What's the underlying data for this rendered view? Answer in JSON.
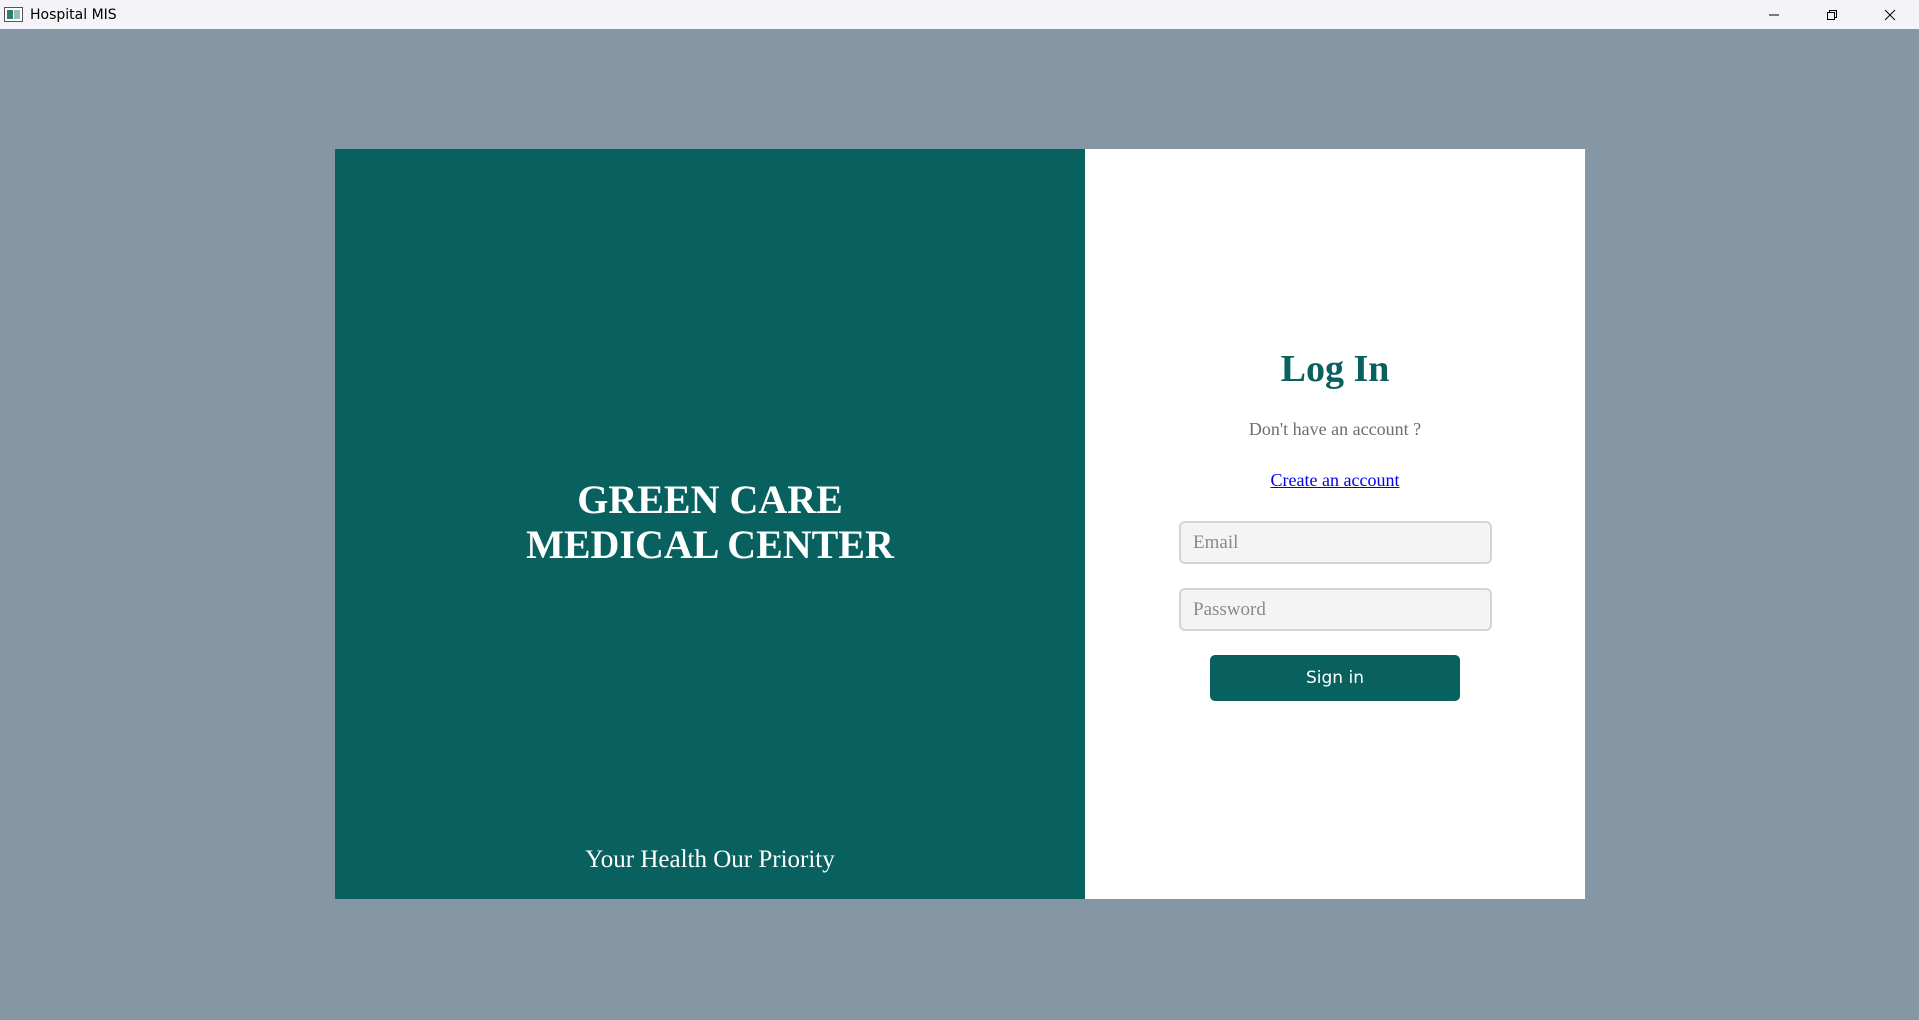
{
  "window": {
    "title": "Hospital MIS",
    "controls": [
      "minimize",
      "restore",
      "close"
    ]
  },
  "brand": {
    "name_line1": "GREEN CARE",
    "name_line2": "MEDICAL CENTER",
    "tagline": "Your Health Our Priority"
  },
  "login": {
    "title": "Log In",
    "no_account_text": "Don't have an account ?",
    "create_account_link": "Create an account",
    "email": {
      "value": "",
      "placeholder": "Email"
    },
    "password": {
      "value": "",
      "placeholder": "Password"
    },
    "sign_in_label": "Sign in"
  },
  "colors": {
    "background": "#8596a5",
    "brand_panel": "#08615f",
    "accent": "#08615f",
    "link": "#0000ee"
  }
}
